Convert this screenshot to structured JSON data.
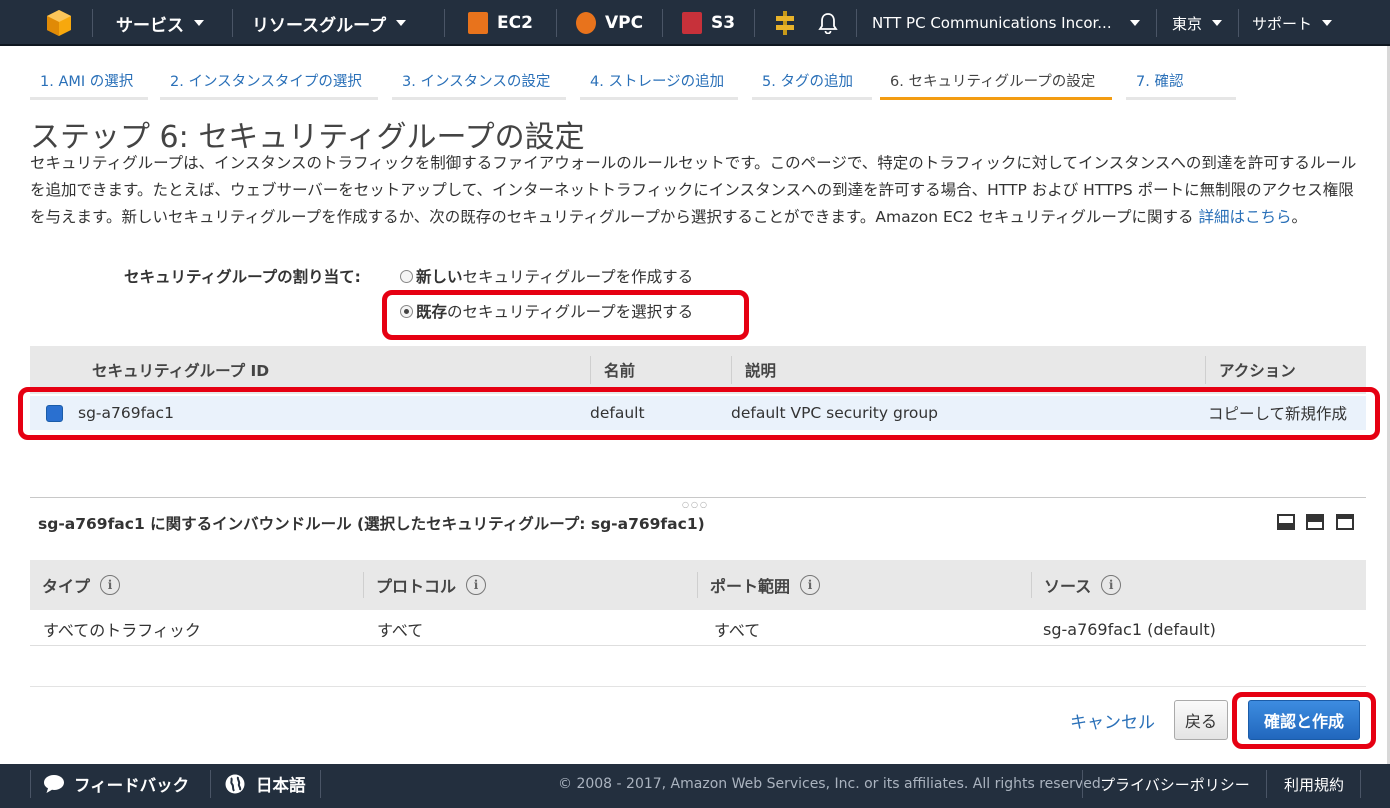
{
  "topnav": {
    "services": "サービス",
    "resource_groups": "リソースグループ",
    "shortcuts": [
      {
        "label": "EC2",
        "icon": "ec2-icon",
        "color": "#e8731c"
      },
      {
        "label": "VPC",
        "icon": "vpc-icon",
        "color": "#e8731c"
      },
      {
        "label": "S3",
        "icon": "s3-icon",
        "color": "#c7313a"
      }
    ],
    "account": "NTT PC Communications Incor...",
    "region": "東京",
    "support": "サポート"
  },
  "steps": [
    {
      "label": "1. AMI の選択"
    },
    {
      "label": "2. インスタンスタイプの選択"
    },
    {
      "label": "3. インスタンスの設定"
    },
    {
      "label": "4. ストレージの追加"
    },
    {
      "label": "5. タグの追加"
    },
    {
      "label": "6. セキュリティグループの設定"
    },
    {
      "label": "7. 確認"
    }
  ],
  "page": {
    "title": "ステップ 6: セキュリティグループの設定",
    "intro": "セキュリティグループは、インスタンスのトラフィックを制御するファイアウォールのルールセットです。このページで、特定のトラフィックに対してインスタンスへの到達を許可するルールを追加できます。たとえば、ウェブサーバーをセットアップして、インターネットトラフィックにインスタンスへの到達を許可する場合、HTTP および HTTPS ポートに無制限のアクセス権限を与えます。新しいセキュリティグループを作成するか、次の既存のセキュリティグループから選択することができます。Amazon EC2 セキュリティグループに関する",
    "intro_link": "詳細はこちら",
    "intro_end": "。"
  },
  "assign": {
    "label": "セキュリティグループの割り当て:",
    "option_new_bold": "新しい",
    "option_new_rest": "セキュリティグループを作成する",
    "option_existing_bold": "既存",
    "option_existing_rest": "のセキュリティグループを選択する",
    "selected": "existing"
  },
  "sg_table": {
    "headers": [
      "セキュリティグループ ID",
      "名前",
      "説明",
      "アクション"
    ],
    "rows": [
      {
        "id": "sg-a769fac1",
        "name": "default",
        "description": "default VPC security group",
        "action": "コピーして新規作成",
        "checked": true
      }
    ]
  },
  "inbound": {
    "title": "sg-a769fac1 に関するインバウンドルール (選択したセキュリティグループ: sg-a769fac1)",
    "headers": [
      "タイプ",
      "プロトコル",
      "ポート範囲",
      "ソース"
    ],
    "info_glyph": "i",
    "rows": [
      {
        "type": "すべてのトラフィック",
        "protocol": "すべて",
        "port": "すべて",
        "source": "sg-a769fac1 (default)"
      }
    ]
  },
  "actions": {
    "cancel": "キャンセル",
    "back": "戻る",
    "review": "確認と作成"
  },
  "footer": {
    "feedback": "フィードバック",
    "language": "日本語",
    "copyright": "© 2008 - 2017, Amazon Web Services, Inc. or its affiliates. All rights reserved.",
    "privacy": "プライバシーポリシー",
    "terms": "利用規約"
  },
  "colors": {
    "nav_bg": "#232f3e",
    "link": "#2a70b8",
    "active_step": "#f39c12",
    "highlight": "#e60012",
    "primary": "#2167bd"
  }
}
